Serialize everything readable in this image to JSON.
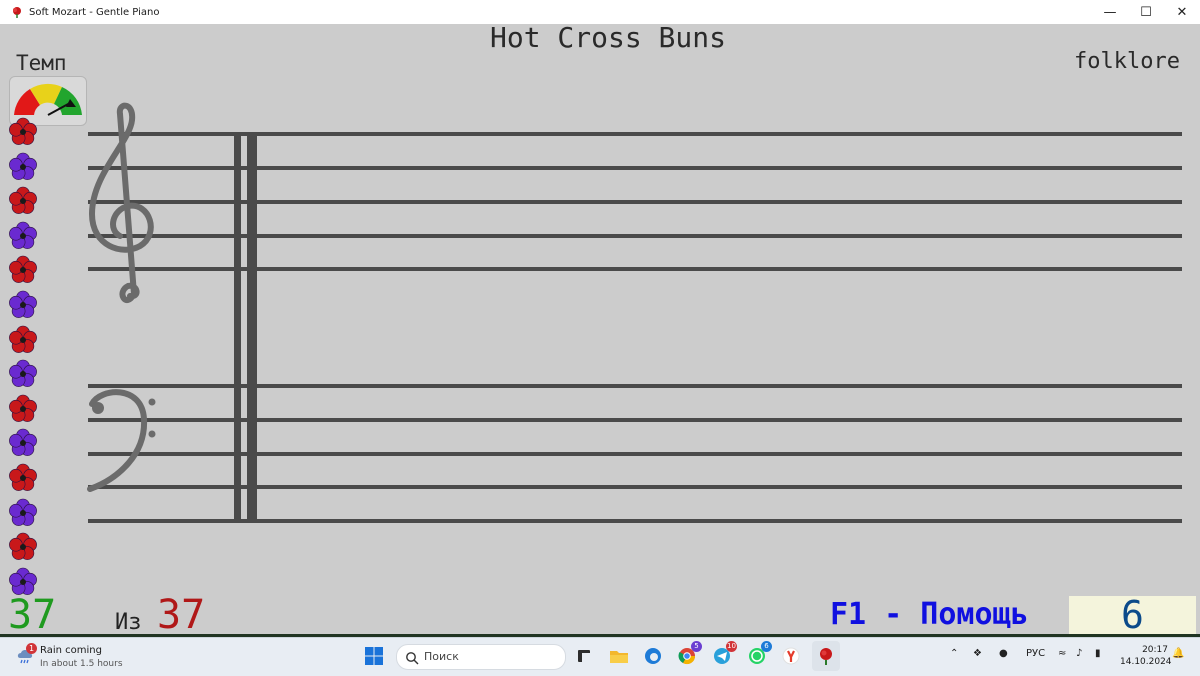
{
  "window": {
    "title": "Soft Mozart - Gentle Piano",
    "minimize_icon": "minimize-icon",
    "maximize_icon": "maximize-icon",
    "close_icon": "close-icon"
  },
  "sheet": {
    "song_title": "Hot Cross Buns",
    "composer": "folklore",
    "tempo_label": "Темп",
    "tempo_gauge_level": 0.8
  },
  "flowers": [
    "red",
    "purple",
    "red",
    "purple",
    "red",
    "purple",
    "red",
    "purple",
    "red",
    "purple",
    "red",
    "purple",
    "red",
    "purple"
  ],
  "colors": {
    "flower_red": "#c8181a",
    "flower_purple": "#6a2ad0",
    "background": "#cccccc",
    "staff_line": "#4a4a4a"
  },
  "status": {
    "current": "37",
    "of_label": "Из",
    "total": "37",
    "help": "F1 - Помощь",
    "score": "6"
  },
  "taskbar": {
    "weather_badge": "1",
    "weather_title": "Rain coming",
    "weather_sub": "In about 1.5 hours",
    "search_placeholder": "Поиск",
    "apps": [
      {
        "icon": "task-view-icon"
      },
      {
        "icon": "file-explorer-icon"
      },
      {
        "icon": "edge-browser-icon"
      },
      {
        "icon": "chrome-browser-icon",
        "badge": "5"
      },
      {
        "icon": "telegram-icon",
        "badge": "10"
      },
      {
        "icon": "whatsapp-icon",
        "badge": "6"
      },
      {
        "icon": "yandex-browser-icon"
      },
      {
        "icon": "soft-mozart-icon"
      }
    ],
    "language": "РУС",
    "time": "20:17",
    "date": "14.10.2024"
  }
}
